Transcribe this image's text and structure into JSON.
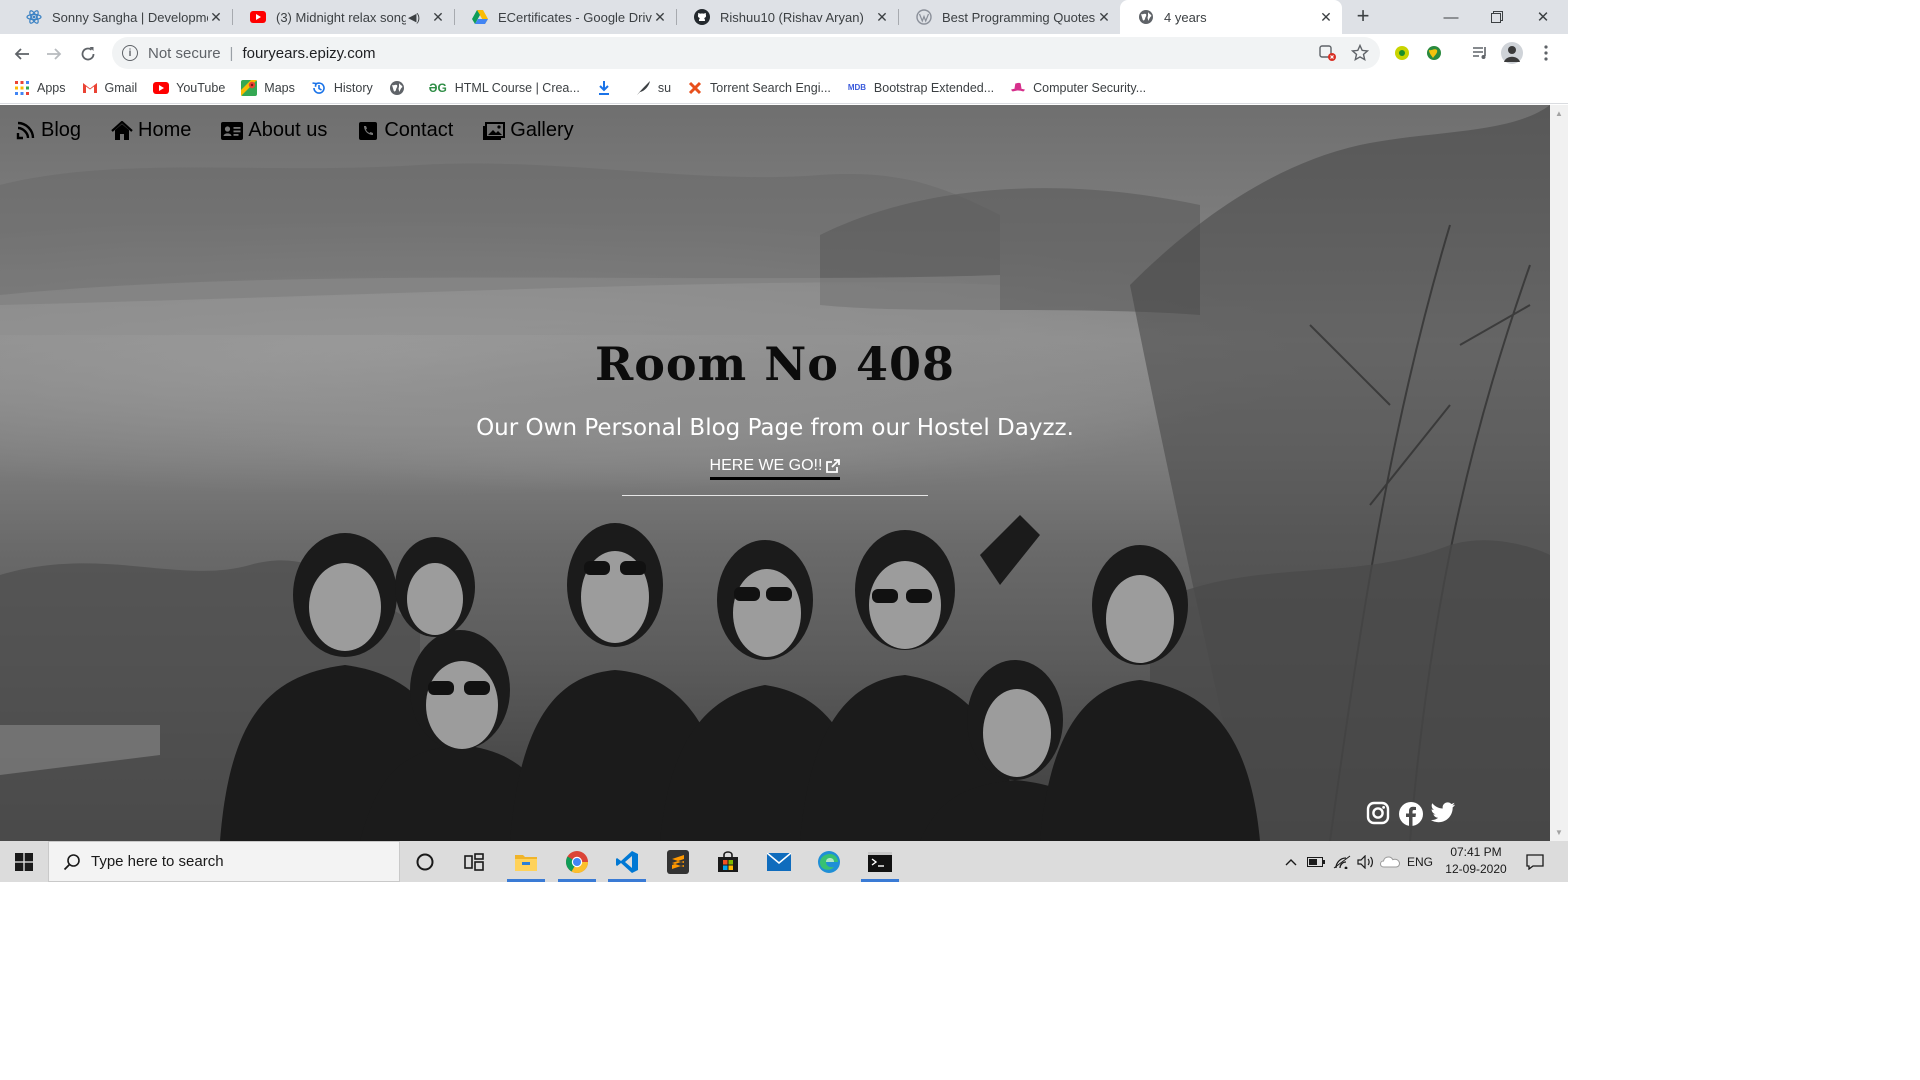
{
  "browser": {
    "tabs": [
      {
        "title": "Sonny Sangha | Developmen",
        "favicon": "react-atom-icon",
        "active": false
      },
      {
        "title": "(3) Midnight relax song h",
        "favicon": "youtube-icon",
        "active": false
      },
      {
        "title": "ECertificates - Google Drive",
        "favicon": "google-drive-icon",
        "active": false
      },
      {
        "title": "Rishuu10 (Rishav Aryan)",
        "favicon": "github-icon",
        "active": false
      },
      {
        "title": "Best Programming Quotes -",
        "favicon": "wordpress-icon",
        "active": false
      },
      {
        "title": "4 years",
        "favicon": "globe-icon",
        "active": true
      }
    ],
    "address": {
      "security_label": "Not secure",
      "url": "fouryears.epizy.com"
    },
    "bookmarks": [
      {
        "label": "Apps",
        "icon": "apps-grid-icon"
      },
      {
        "label": "Gmail",
        "icon": "gmail-icon"
      },
      {
        "label": "YouTube",
        "icon": "youtube-icon"
      },
      {
        "label": "Maps",
        "icon": "maps-icon"
      },
      {
        "label": "History",
        "icon": "history-icon"
      },
      {
        "label": "",
        "icon": "globe-icon"
      },
      {
        "label": "HTML Course | Crea...",
        "icon": "geeksforgeeks-icon"
      },
      {
        "label": "",
        "icon": "download-icon"
      },
      {
        "label": "su",
        "icon": "feather-icon"
      },
      {
        "label": "Torrent Search Engi...",
        "icon": "x-icon"
      },
      {
        "label": "Bootstrap Extended...",
        "icon": "mdb-icon"
      },
      {
        "label": "Computer Security...",
        "icon": "hat-icon"
      }
    ]
  },
  "site": {
    "nav": [
      {
        "label": "Blog",
        "icon": "blog-icon"
      },
      {
        "label": "Home",
        "icon": "home-icon"
      },
      {
        "label": "About us",
        "icon": "id-card-icon"
      },
      {
        "label": "Contact",
        "icon": "phone-icon"
      },
      {
        "label": "Gallery",
        "icon": "gallery-icon"
      }
    ],
    "hero": {
      "title": "Room No 408",
      "subtitle": "Our Own Personal Blog Page from our Hostel Dayzz.",
      "cta": "HERE WE GO!!"
    },
    "social": [
      "instagram-icon",
      "facebook-icon",
      "twitter-icon"
    ]
  },
  "taskbar": {
    "search_placeholder": "Type here to search",
    "apps": [
      "cortana-icon",
      "task-view-icon",
      "file-explorer-icon",
      "chrome-icon",
      "vscode-icon",
      "sublime-text-icon",
      "store-icon",
      "mail-icon",
      "edge-icon",
      "terminal-icon"
    ],
    "language": "ENG",
    "time": "07:41 PM",
    "date": "12-09-2020"
  }
}
